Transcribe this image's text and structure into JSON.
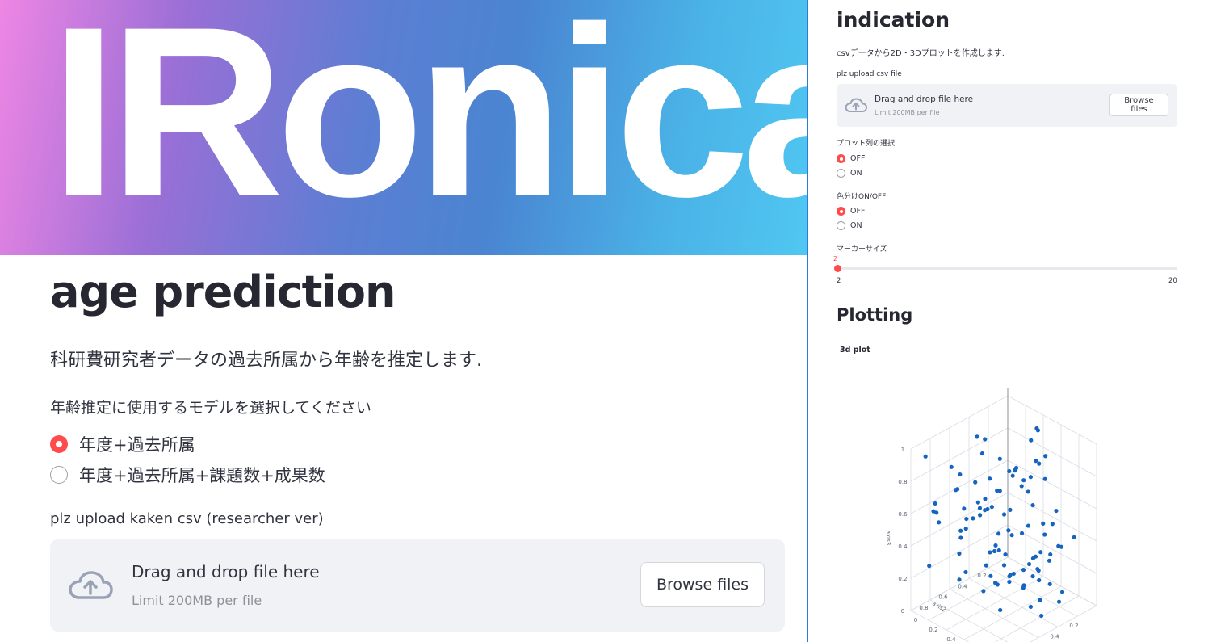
{
  "main": {
    "banner_text": "IRonical",
    "title": "age prediction",
    "description": "科研費研究者データの過去所属から年齢を推定します.",
    "model_label": "年齢推定に使用するモデルを選択してください",
    "model_options": [
      {
        "label": "年度+過去所属",
        "selected": true
      },
      {
        "label": "年度+過去所属+課題数+成果数",
        "selected": false
      }
    ],
    "upload_label": "plz upload kaken csv (researcher ver)",
    "dropzone": {
      "title": "Drag and drop file here",
      "limit": "Limit 200MB per file",
      "button": "Browse files",
      "icon": "cloud-upload-icon"
    }
  },
  "sidebar": {
    "title": "indication",
    "description": "csvデータから2D・3Dプロットを作成します.",
    "upload_label": "plz upload csv file",
    "dropzone": {
      "title": "Drag and drop file here",
      "limit": "Limit 200MB per file",
      "button": "Browse files"
    },
    "plot_column_label": "プロット列の選択",
    "plot_column_options": [
      {
        "label": "OFF",
        "selected": true
      },
      {
        "label": "ON",
        "selected": false
      }
    ],
    "color_label": "色分けON/OFF",
    "color_options": [
      {
        "label": "OFF",
        "selected": true
      },
      {
        "label": "ON",
        "selected": false
      }
    ],
    "marker_label": "マーカーサイズ",
    "slider": {
      "value": "2",
      "min": "2",
      "max": "20"
    },
    "plotting_title": "Plotting",
    "plot_subtitle": "3d plot"
  },
  "colors": {
    "accent": "#ff4b4b",
    "marker": "#1565c0",
    "dropzone_bg": "#f0f2f6",
    "text": "#31333f"
  },
  "chart_data": {
    "type": "scatter",
    "title": "3d plot",
    "axes": {
      "x": {
        "label": "axis1",
        "ticks": [
          "0",
          "0.2",
          "0.4",
          "0.6",
          "0.8"
        ]
      },
      "y": {
        "label": "axis2",
        "ticks": [
          "0.2",
          "0.4",
          "0.6",
          "0.8"
        ]
      },
      "z": {
        "label": "axis3",
        "ticks": [
          "0",
          "0.2",
          "0.4",
          "0.6",
          "0.8",
          "1"
        ]
      }
    },
    "point_count": 100
  }
}
